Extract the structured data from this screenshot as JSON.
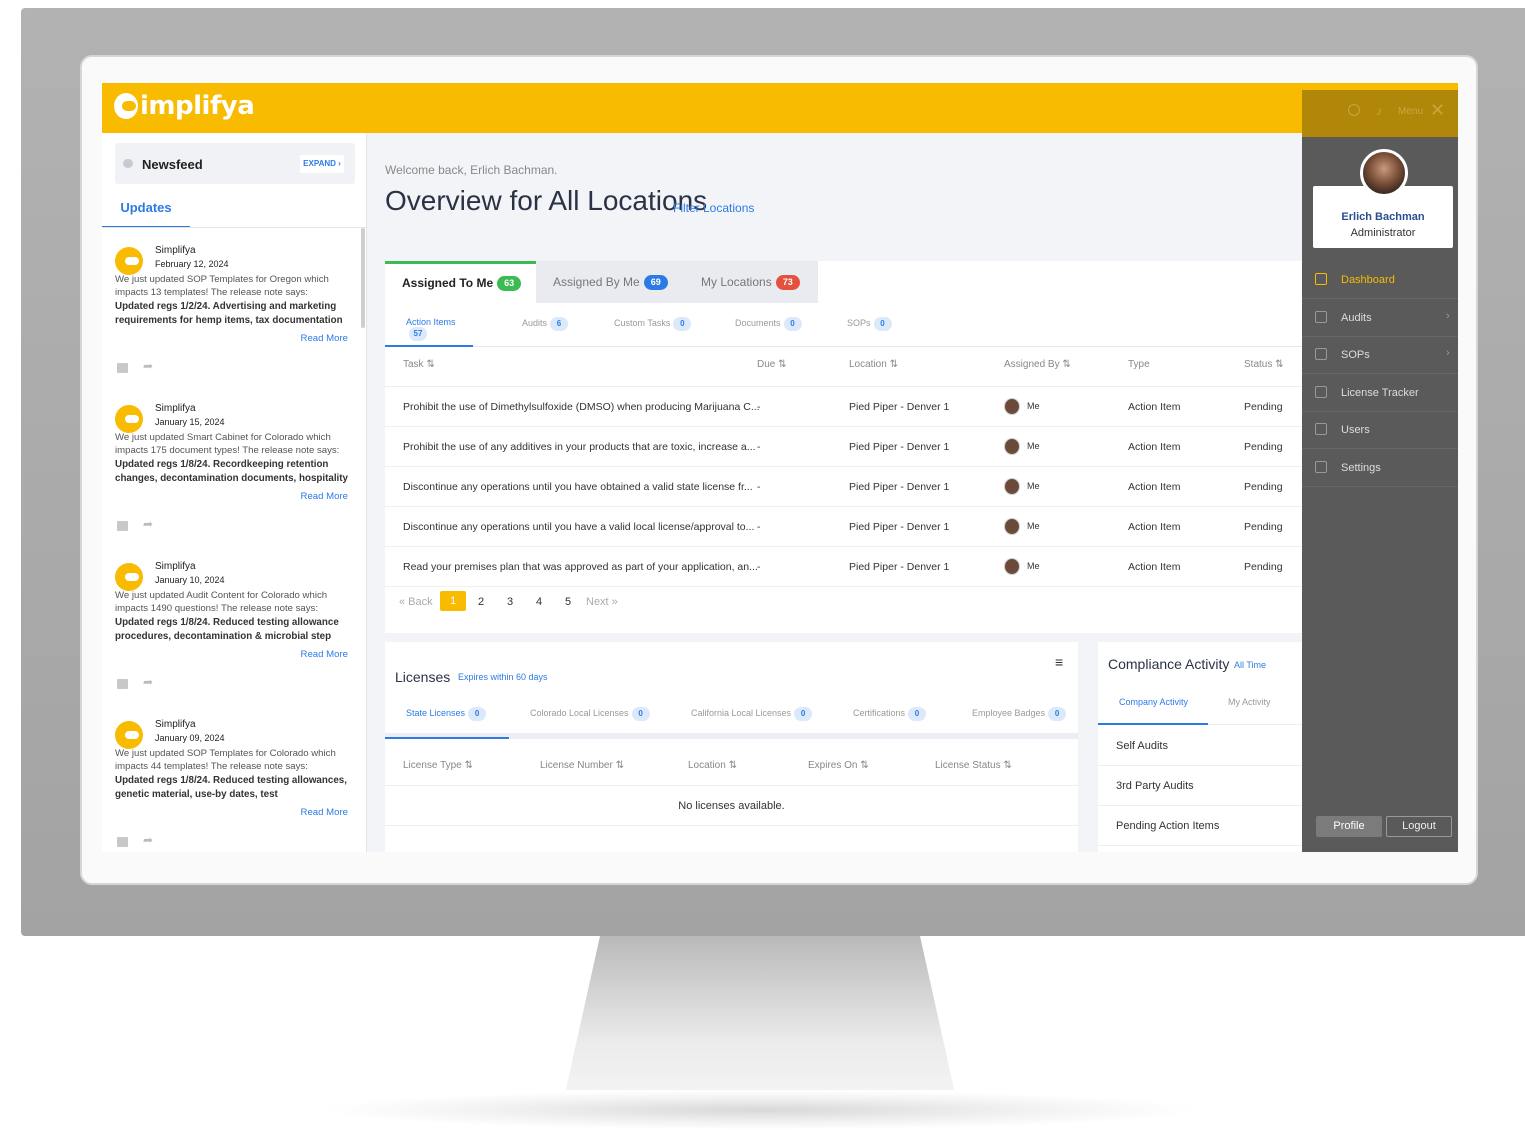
{
  "app": {
    "logo_text": "implifya",
    "brand_color": "#f8bb00",
    "accent_color": "#2c7be5"
  },
  "newsfeed": {
    "title": "Newsfeed",
    "expand_label": "EXPAND ›",
    "tab_label": "Updates",
    "items": [
      {
        "author": "Simplifya",
        "date": "February 12, 2024",
        "text": "We just updated SOP Templates for Oregon which impacts 13 templates! The release note says:",
        "highlight": "Updated regs 1/2/24. Advertising and marketing requirements for hemp items, tax documentation",
        "read_more": "Read More"
      },
      {
        "author": "Simplifya",
        "date": "January 15, 2024",
        "text": "We just updated Smart Cabinet for Colorado which impacts 175 document types! The release note says:",
        "highlight": "Updated regs 1/8/24. Recordkeeping retention changes, decontamination documents, hospitality",
        "read_more": "Read More"
      },
      {
        "author": "Simplifya",
        "date": "January 10, 2024",
        "text": "We just updated Audit Content for Colorado which impacts 1490 questions! The release note says:",
        "highlight": "Updated regs 1/8/24. Reduced testing allowance procedures, decontamination & microbial step",
        "read_more": "Read More"
      },
      {
        "author": "Simplifya",
        "date": "January 09, 2024",
        "text": "We just updated SOP Templates for Colorado which impacts 44 templates! The release note says:",
        "highlight": "Updated regs 1/8/24. Reduced testing allowances, genetic material, use-by dates, test",
        "read_more": "Read More"
      }
    ]
  },
  "main": {
    "welcome": "Welcome back, Erlich Bachman.",
    "title": "Overview for All Locations",
    "filter_link": "Filter Locations",
    "tabs": [
      {
        "label": "Assigned To Me",
        "count": "63"
      },
      {
        "label": "Assigned By Me",
        "count": "69"
      },
      {
        "label": "My Locations",
        "count": "73"
      }
    ],
    "subtabs": [
      {
        "label": "Action Items",
        "count": "57"
      },
      {
        "label": "Audits",
        "count": "6"
      },
      {
        "label": "Custom Tasks",
        "count": "0"
      },
      {
        "label": "Documents",
        "count": "0"
      },
      {
        "label": "SOPs",
        "count": "0"
      }
    ],
    "columns": [
      "Task ⇅",
      "Due ⇅",
      "Location ⇅",
      "Assigned By ⇅",
      "Type",
      "Status ⇅"
    ],
    "rows": [
      {
        "task": "Prohibit the use of Dimethylsulfoxide (DMSO) when producing Marijuana C...",
        "due": "-",
        "location": "Pied Piper - Denver 1",
        "assigned_by": "Me",
        "type": "Action Item",
        "status": "Pending"
      },
      {
        "task": "Prohibit the use of any additives in your products that are toxic, increase a...",
        "due": "-",
        "location": "Pied Piper - Denver 1",
        "assigned_by": "Me",
        "type": "Action Item",
        "status": "Pending"
      },
      {
        "task": "Discontinue any operations until you have obtained a valid state license fr...",
        "due": "-",
        "location": "Pied Piper - Denver 1",
        "assigned_by": "Me",
        "type": "Action Item",
        "status": "Pending"
      },
      {
        "task": "Discontinue any operations until you have a valid local license/approval to...",
        "due": "-",
        "location": "Pied Piper - Denver 1",
        "assigned_by": "Me",
        "type": "Action Item",
        "status": "Pending"
      },
      {
        "task": "Read your premises plan that was approved as part of your application, an...",
        "due": "-",
        "location": "Pied Piper - Denver 1",
        "assigned_by": "Me",
        "type": "Action Item",
        "status": "Pending"
      }
    ],
    "pager": {
      "back": "« Back",
      "pages": [
        "1",
        "2",
        "3",
        "4",
        "5"
      ],
      "next": "Next »",
      "current": "1"
    }
  },
  "licenses": {
    "title": "Licenses",
    "subtitle": "Expires within 60 days",
    "tabs": [
      {
        "label": "State Licenses",
        "count": "0"
      },
      {
        "label": "Colorado Local Licenses",
        "count": "0"
      },
      {
        "label": "California Local Licenses",
        "count": "0"
      },
      {
        "label": "Certifications",
        "count": "0"
      },
      {
        "label": "Employee Badges",
        "count": "0"
      }
    ],
    "columns": [
      "License Type ⇅",
      "License Number ⇅",
      "Location ⇅",
      "Expires On ⇅",
      "License Status ⇅"
    ],
    "empty": "No licenses available."
  },
  "compliance": {
    "title": "Compliance Activity",
    "subtitle": "All Time",
    "tabs": [
      "Company Activity",
      "My Activity"
    ],
    "items": [
      "Self Audits",
      "3rd Party Audits",
      "Pending Action Items"
    ]
  },
  "side_menu": {
    "menu_label": "Menu",
    "close_icon": "✕",
    "user_name": "Erlich Bachman",
    "user_role": "Administrator",
    "items": [
      {
        "label": "Dashboard",
        "icon": "home-icon",
        "active": true
      },
      {
        "label": "Audits",
        "icon": "audit-icon"
      },
      {
        "label": "SOPs",
        "icon": "sop-icon"
      },
      {
        "label": "License Tracker",
        "icon": "license-icon"
      },
      {
        "label": "Users",
        "icon": "users-icon"
      },
      {
        "label": "Settings",
        "icon": "gear-icon"
      }
    ],
    "profile_label": "Profile",
    "logout_label": "Logout"
  }
}
